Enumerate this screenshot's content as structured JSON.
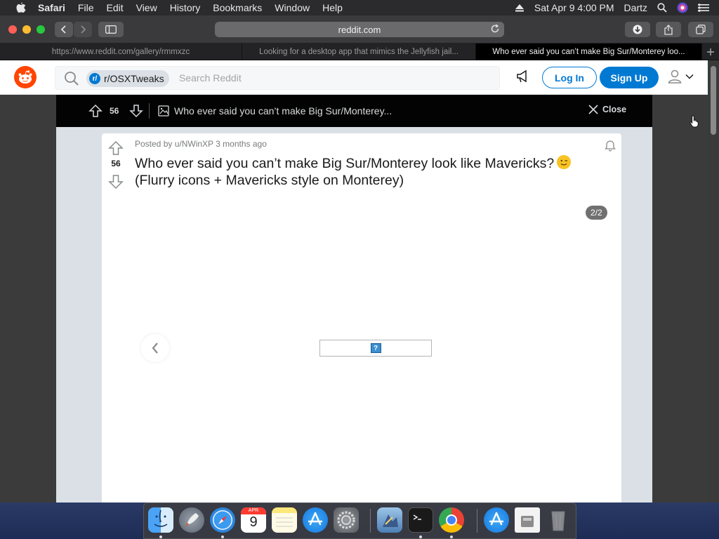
{
  "menubar": {
    "apple_icon": "apple-logo-icon",
    "items": [
      "Safari",
      "File",
      "Edit",
      "View",
      "History",
      "Bookmarks",
      "Window",
      "Help"
    ],
    "datetime": "Sat Apr 9  4:00 PM",
    "user": "Dartz"
  },
  "toolbar": {
    "url": "reddit.com"
  },
  "tabs": [
    {
      "label": "https://www.reddit.com/gallery/rmmxzc"
    },
    {
      "label": "Looking for a desktop app that mimics the Jellyfish jail..."
    },
    {
      "label": "Who ever said you can’t make Big Sur/Monterey loo..."
    }
  ],
  "reddit_header": {
    "community": "r/OSXTweaks",
    "community_icon_letter": "r/",
    "search_placeholder": "Search Reddit",
    "login_label": "Log In",
    "signup_label": "Sign Up"
  },
  "post_bar": {
    "vote_count": "56",
    "title": "Who ever said you can’t make Big Sur/Monterey...",
    "close_label": "Close"
  },
  "post": {
    "vote_count": "56",
    "meta": "Posted by u/NWinXP 3 months ago",
    "title": "Who ever said you can’t make Big Sur/Monterey look like Mavericks?",
    "title_line2": "(Flurry icons + Mavericks style on Monterey)",
    "gallery_counter": "2/2",
    "broken_image_glyph": "?"
  },
  "dock": {
    "calendar_month": "APR",
    "calendar_day": "9",
    "apps": [
      "finder",
      "launchpad",
      "safari",
      "calendar",
      "notes",
      "app-store",
      "system-preferences",
      "preview",
      "terminal",
      "chrome",
      "app-store-2",
      "disk-image",
      "trash"
    ]
  },
  "colors": {
    "reddit_orange": "#ff4500",
    "reddit_blue": "#0079d3"
  }
}
